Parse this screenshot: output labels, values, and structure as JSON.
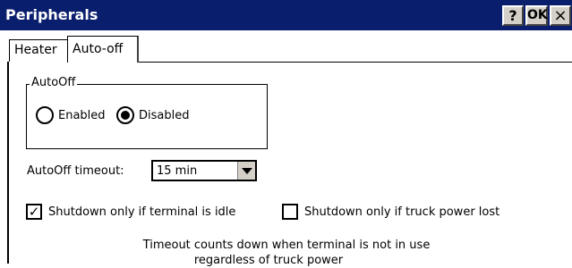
{
  "window": {
    "title": "Peripherals",
    "help_label": "?",
    "ok_label": "OK",
    "close_label": "×"
  },
  "tabs": [
    {
      "label": "Heater",
      "selected": false
    },
    {
      "label": "Auto-off",
      "selected": true
    }
  ],
  "autooff_group": {
    "title": "AutoOff",
    "options": [
      {
        "label": "Enabled",
        "checked": false
      },
      {
        "label": "Disabled",
        "checked": true
      }
    ]
  },
  "timeout": {
    "label": "AutoOff timeout:",
    "value": "15 min"
  },
  "checkboxes": [
    {
      "label": "Shutdown only if terminal is idle",
      "checked": true,
      "mark": "✓"
    },
    {
      "label": "Shutdown only if truck power lost",
      "checked": false,
      "mark": ""
    }
  ],
  "note": {
    "line1": "Timeout counts down when terminal is not in use",
    "line2": "regardless of truck power"
  },
  "colors": {
    "titlebar": "#0a1e6e",
    "button_face": "#d4d0c8",
    "background": "#ffffff"
  }
}
